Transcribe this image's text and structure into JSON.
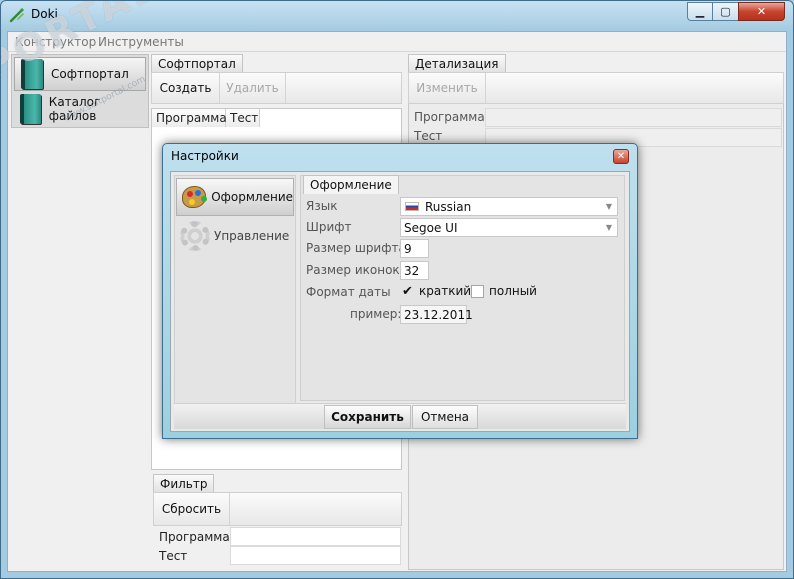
{
  "window": {
    "title": "Doki",
    "min_glyph": "▁",
    "max_glyph": "▢",
    "close_glyph": "✕"
  },
  "menu": [
    "Конструктор",
    "Инструменты"
  ],
  "nav": [
    {
      "label": "Софтпортал",
      "active": true
    },
    {
      "label": "Каталог файлов",
      "active": false
    }
  ],
  "softportal": {
    "tab": "Софтпортал",
    "create": "Создать",
    "delete": "Удалить",
    "columns": [
      "Программа",
      "Тест"
    ]
  },
  "detail": {
    "tab": "Детализация",
    "edit": "Изменить",
    "rows": [
      "Программа",
      "Тест"
    ]
  },
  "filter": {
    "tab": "Фильтр",
    "reset": "Сбросить",
    "rows": [
      "Программа",
      "Тест"
    ]
  },
  "dialog": {
    "title": "Настройки",
    "close_glyph": "✕",
    "nav": [
      {
        "label": "Оформление",
        "active": true,
        "icon": "palette-icon"
      },
      {
        "label": "Управление",
        "active": false,
        "icon": "gear-icon"
      }
    ],
    "tab": "Оформление",
    "language_label": "Язык",
    "language_value": "Russian",
    "font_label": "Шрифт",
    "font_value": "Segoe UI",
    "font_size_label": "Размер шрифта",
    "font_size_value": "9",
    "icon_size_label": "Размер иконок",
    "icon_size_value": "32",
    "date_format_label": "Формат даты",
    "date_short": {
      "label": "краткий",
      "checked": true,
      "mark": "✔"
    },
    "date_long": {
      "label": "полный",
      "checked": false
    },
    "example_label": "пример:",
    "example_value": "23.12.2011",
    "save": "Сохранить",
    "cancel": "Отмена"
  },
  "watermark": {
    "text": "PORTAL",
    "url": "www.softportal.com"
  }
}
